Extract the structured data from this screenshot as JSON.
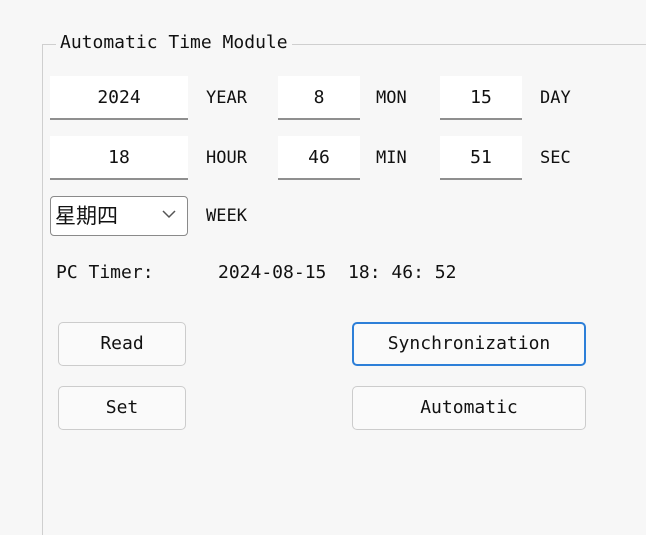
{
  "group": {
    "title": "Automatic Time Module"
  },
  "date": {
    "year_value": "2024",
    "year_unit": "YEAR",
    "month_value": "8",
    "month_unit": "MON",
    "day_value": "15",
    "day_unit": "DAY"
  },
  "time": {
    "hour_value": "18",
    "hour_unit": "HOUR",
    "minute_value": "46",
    "minute_unit": "MIN",
    "second_value": "51",
    "second_unit": "SEC"
  },
  "week": {
    "selected": "星期四",
    "unit": "WEEK"
  },
  "pc_timer": {
    "label": "PC Timer:",
    "value": "2024-08-15  18: 46: 52"
  },
  "buttons": {
    "read": "Read",
    "set": "Set",
    "synchronization": "Synchronization",
    "automatic": "Automatic"
  },
  "icons": {
    "dropdown": "chevron-down-icon"
  },
  "colors": {
    "focus_border": "#2d7fd8",
    "field_underline": "#8f8f8f",
    "panel_background": "#f7f7f7"
  }
}
